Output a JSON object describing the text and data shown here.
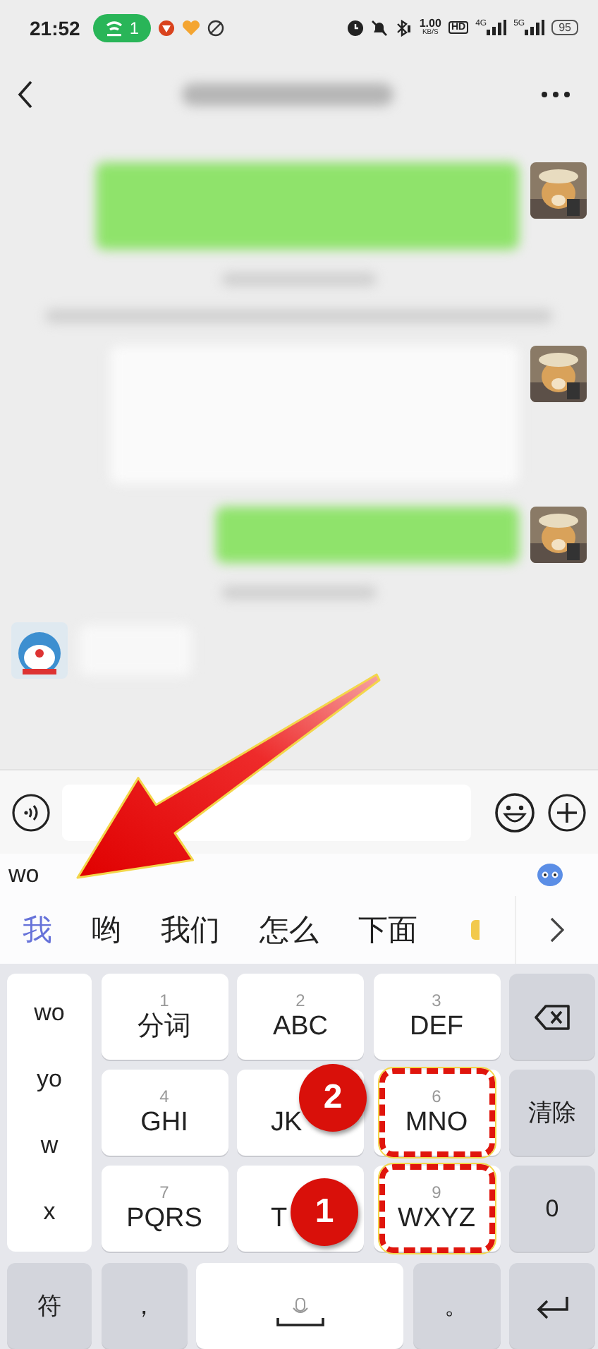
{
  "status_bar": {
    "time": "21:52",
    "hotspot_count": "1",
    "speed": "1.00",
    "speed_unit": "KB/S",
    "hd": "HD",
    "net_a": "4G",
    "net_b": "5G",
    "battery": "95"
  },
  "ime": {
    "composition": "wo",
    "candidates": [
      {
        "text": "我",
        "selected": true
      },
      {
        "text": "哟",
        "selected": false
      },
      {
        "text": "我们",
        "selected": false
      },
      {
        "text": "怎么",
        "selected": false
      },
      {
        "text": "下面",
        "selected": false
      }
    ]
  },
  "keyboard": {
    "pinyin_options": [
      "wo",
      "yo",
      "w",
      "x"
    ],
    "keys": [
      {
        "kind": "letter",
        "digit": "1",
        "label": "分词",
        "highlighted": false
      },
      {
        "kind": "letter",
        "digit": "2",
        "label": "ABC",
        "highlighted": false
      },
      {
        "kind": "letter",
        "digit": "3",
        "label": "DEF",
        "highlighted": false
      },
      {
        "kind": "backspace"
      },
      {
        "kind": "letter",
        "digit": "4",
        "label": "GHI",
        "highlighted": false
      },
      {
        "kind": "letter",
        "label": "JK",
        "highlighted": false,
        "badge": "2"
      },
      {
        "kind": "letter",
        "digit": "6",
        "label": "MNO",
        "highlighted": true
      },
      {
        "kind": "action",
        "label": "清除"
      },
      {
        "kind": "letter",
        "digit": "7",
        "label": "PQRS",
        "highlighted": false
      },
      {
        "kind": "letter",
        "label": "T",
        "highlighted": false,
        "badge": "1"
      },
      {
        "kind": "letter",
        "digit": "9",
        "label": "WXYZ",
        "highlighted": true
      },
      {
        "kind": "action",
        "label": "0"
      }
    ],
    "bottom_keys": [
      {
        "kind": "action",
        "label": "符"
      },
      {
        "kind": "action",
        "label": "，"
      },
      {
        "kind": "space"
      },
      {
        "kind": "action",
        "label": "。"
      },
      {
        "kind": "enter"
      }
    ]
  }
}
